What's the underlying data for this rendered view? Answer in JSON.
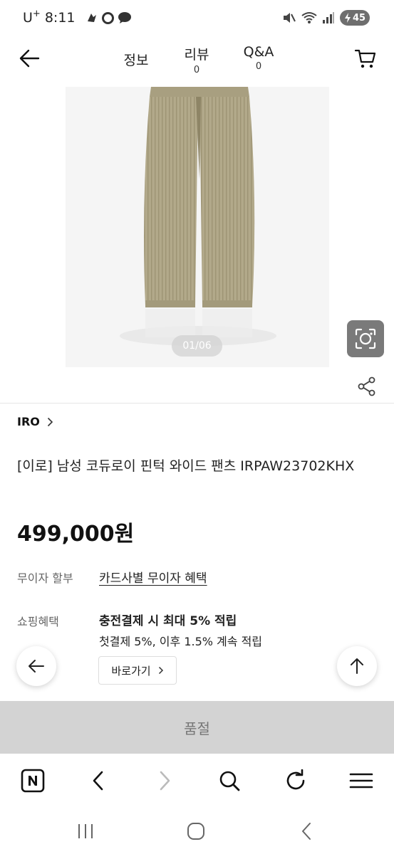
{
  "status_bar": {
    "carrier": "U",
    "carrier_sup": "+",
    "time": "8:11",
    "battery": "45"
  },
  "nav": {
    "tabs": [
      {
        "label": "정보",
        "count": ""
      },
      {
        "label": "리뷰",
        "count": "0"
      },
      {
        "label": "Q&A",
        "count": "0"
      }
    ]
  },
  "gallery": {
    "pager": "01/06"
  },
  "product": {
    "brand": "IRO",
    "title": "[이로] 남성 코듀로이 핀턱 와이드 팬츠 IRPAW23702KHX",
    "price": "499,000원"
  },
  "benefits": {
    "installment_label": "무이자 할부",
    "installment_value": "카드사별 무이자 혜택",
    "shopping_label": "쇼핑혜택",
    "shopping_line1": "충전결제 시 최대 5% 적립",
    "shopping_line2": "첫결제 5%, 이후 1.5% 계속 적립",
    "goto_label": "바로가기"
  },
  "cta": {
    "soldout_label": "품절"
  },
  "colors": {
    "soldout_bg": "#d3d3d3",
    "pants": "#b2a98a"
  },
  "icons": {
    "back": "arrow-left-icon",
    "cart": "cart-icon",
    "lens": "image-search-icon",
    "share": "share-icon",
    "scroll_top": "arrow-up-icon",
    "browser_home": "naver-n-icon",
    "search": "search-icon",
    "refresh": "refresh-icon",
    "menu": "hamburger-icon"
  }
}
